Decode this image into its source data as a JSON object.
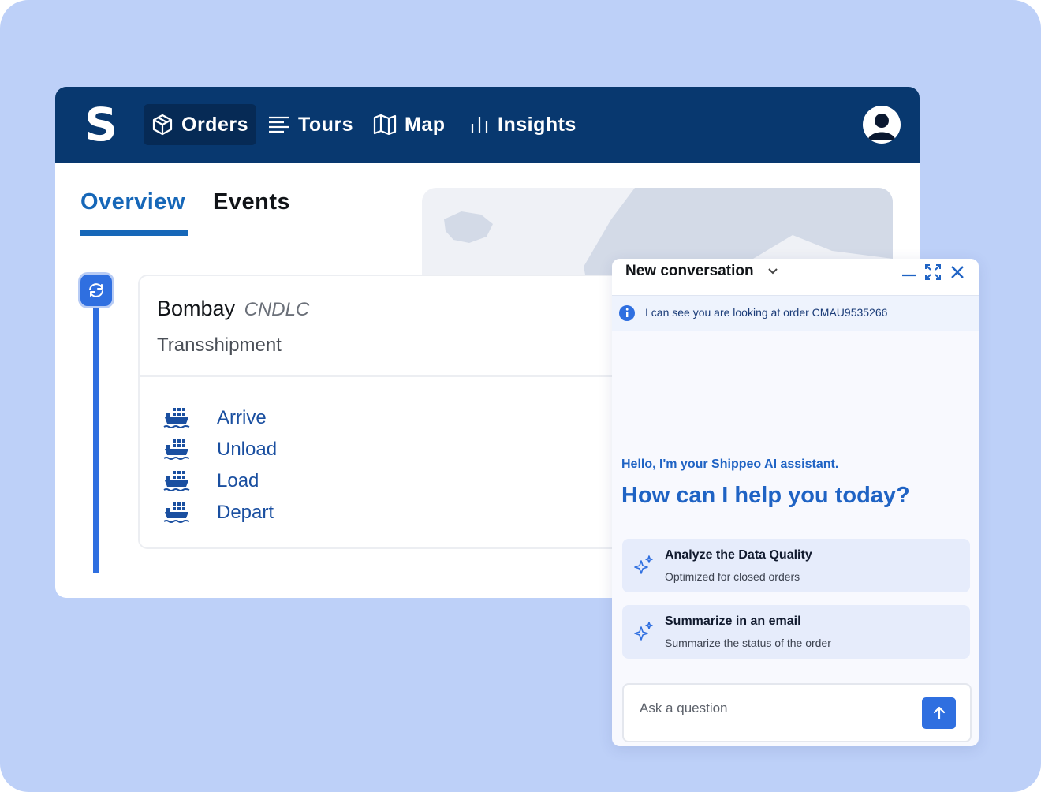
{
  "nav": {
    "logo": "S",
    "items": [
      {
        "label": "Orders",
        "icon": "box-icon",
        "active": true
      },
      {
        "label": "Tours",
        "icon": "lines-icon",
        "active": false
      },
      {
        "label": "Map",
        "icon": "map-icon",
        "active": false
      },
      {
        "label": "Insights",
        "icon": "bar-chart-icon",
        "active": false
      }
    ],
    "avatar_icon": "user-avatar-icon"
  },
  "tabs": [
    {
      "label": "Overview",
      "active": true
    },
    {
      "label": "Events",
      "active": false
    }
  ],
  "port": {
    "name": "Bombay",
    "code": "CNDLC",
    "type": "Transshipment",
    "events": [
      {
        "label": "Arrive",
        "icon": "ship-icon"
      },
      {
        "label": "Unload",
        "icon": "ship-icon"
      },
      {
        "label": "Load",
        "icon": "ship-icon"
      },
      {
        "label": "Depart",
        "icon": "ship-icon"
      }
    ]
  },
  "chat": {
    "title": "New conversation",
    "info": "I can see you are looking at order CMAU9535266",
    "hello": "Hello, I'm your Shippeo AI assistant.",
    "help": "How can I help you today?",
    "suggestions": [
      {
        "title": "Analyze the Data Quality",
        "subtitle": "Optimized for closed orders"
      },
      {
        "title": "Summarize in an email",
        "subtitle": "Summarize the status of the order"
      }
    ],
    "input_placeholder": "Ask a question",
    "input_value": ""
  },
  "colors": {
    "backdrop": "#bdd0f8",
    "navbar": "#08386f",
    "accent": "#2f6fe0",
    "tab_active": "#1667b8",
    "assistant_text": "#1f63c4"
  }
}
